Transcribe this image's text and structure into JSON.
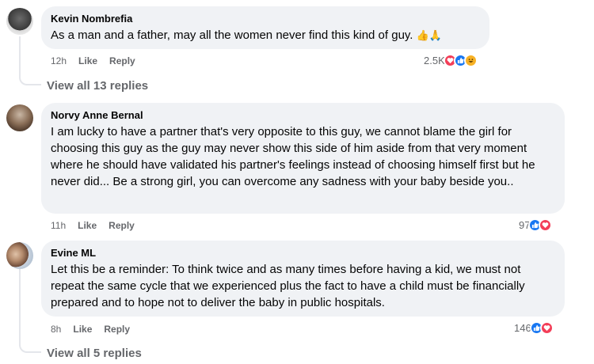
{
  "comments": [
    {
      "author": "Kevin Nombrefia",
      "text": "As a man and a father, may all the women never find this kind of guy.",
      "emoji": "👍🙏",
      "time": "12h",
      "like_label": "Like",
      "reply_label": "Reply",
      "reaction_count": "2.5K",
      "reactions": [
        "love",
        "like",
        "haha"
      ],
      "view_replies": "View all 13 replies"
    },
    {
      "author": "Norvy Anne Bernal",
      "text": "I am lucky to have a partner that's very opposite to this guy, we cannot blame the girl for choosing this guy as the guy may never show this side of him aside from that very moment where he should have validated his partner's feelings instead of choosing himself first but he never did... Be a strong girl, you can overcome any sadness with your baby beside you..",
      "time": "11h",
      "like_label": "Like",
      "reply_label": "Reply",
      "reaction_count": "97",
      "reactions": [
        "like",
        "love"
      ]
    },
    {
      "author": "Evine ML",
      "text": "Let this be a reminder: To think twice and as many times before having a kid, we must not repeat the same cycle that we experienced plus the fact to have a child must be financially prepared and to hope not to deliver the baby in public hospitals.",
      "time": "8h",
      "like_label": "Like",
      "reply_label": "Reply",
      "reaction_count": "146",
      "reactions": [
        "like",
        "love"
      ],
      "view_replies": "View all 5 replies"
    }
  ],
  "colors": {
    "bubble": "#f0f2f5",
    "meta_text": "#65676b",
    "like_blue": "#1877f2",
    "love_red": "#f33e58",
    "haha_yellow": "#f7b125"
  }
}
